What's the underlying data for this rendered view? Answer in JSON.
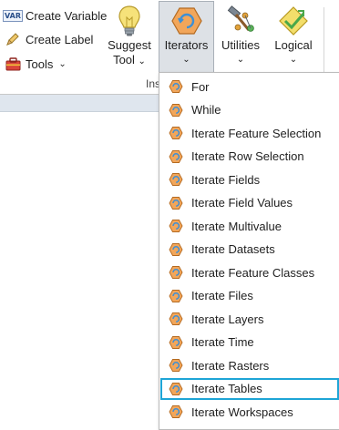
{
  "ribbon": {
    "small_buttons": {
      "create_variable": {
        "label": "Create Variable",
        "icon": "var-icon",
        "icon_text": "VAR"
      },
      "create_label": {
        "label": "Create Label",
        "icon": "label-pencil-icon"
      },
      "tools": {
        "label": "Tools",
        "icon": "toolbox-icon",
        "caret": "⌄"
      }
    },
    "big_buttons": {
      "suggest_tool": {
        "line1": "Suggest",
        "line2": "Tool",
        "caret": "⌄",
        "icon": "lightbulb-icon"
      },
      "iterators": {
        "label": "Iterators",
        "caret": "⌄",
        "icon": "iterator-icon",
        "active": true
      },
      "utilities": {
        "label": "Utilities",
        "caret": "⌄",
        "icon": "hammer-utilities-icon"
      },
      "logical": {
        "label": "Logical",
        "caret": "⌄",
        "icon": "logical-diamond-icon"
      }
    },
    "group_label": "Ins"
  },
  "iterators_menu": {
    "items": [
      {
        "label": "For",
        "icon": "iterator-icon",
        "selected": false
      },
      {
        "label": "While",
        "icon": "iterator-icon",
        "selected": false
      },
      {
        "label": "Iterate Feature Selection",
        "icon": "iterator-icon",
        "selected": false
      },
      {
        "label": "Iterate Row Selection",
        "icon": "iterator-icon",
        "selected": false
      },
      {
        "label": "Iterate Fields",
        "icon": "iterator-icon",
        "selected": false
      },
      {
        "label": "Iterate Field Values",
        "icon": "iterator-icon",
        "selected": false
      },
      {
        "label": "Iterate Multivalue",
        "icon": "iterator-icon",
        "selected": false
      },
      {
        "label": "Iterate Datasets",
        "icon": "iterator-icon",
        "selected": false
      },
      {
        "label": "Iterate Feature Classes",
        "icon": "iterator-icon",
        "selected": false
      },
      {
        "label": "Iterate Files",
        "icon": "iterator-icon",
        "selected": false
      },
      {
        "label": "Iterate Layers",
        "icon": "iterator-icon",
        "selected": false
      },
      {
        "label": "Iterate Time",
        "icon": "iterator-icon",
        "selected": false
      },
      {
        "label": "Iterate Rasters",
        "icon": "iterator-icon",
        "selected": false
      },
      {
        "label": "Iterate Tables",
        "icon": "iterator-icon",
        "selected": true
      },
      {
        "label": "Iterate Workspaces",
        "icon": "iterator-icon",
        "selected": false
      }
    ]
  },
  "colors": {
    "selection_outline": "#1ea5d6",
    "iterator_orange": "#f2a65a",
    "iterator_blue": "#3d8fd6"
  }
}
